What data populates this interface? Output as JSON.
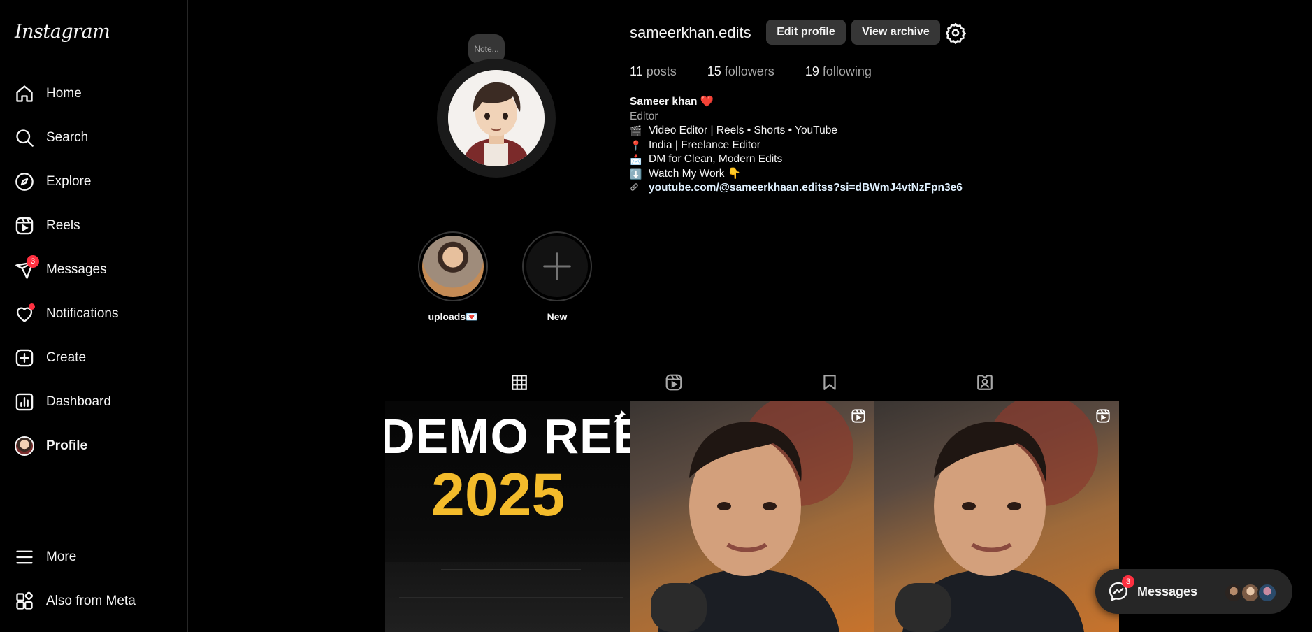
{
  "app": {
    "logo": "Instagram"
  },
  "sidebar": {
    "items": [
      {
        "label": "Home",
        "icon": "home-icon"
      },
      {
        "label": "Search",
        "icon": "search-icon"
      },
      {
        "label": "Explore",
        "icon": "explore-icon"
      },
      {
        "label": "Reels",
        "icon": "reels-icon"
      },
      {
        "label": "Messages",
        "icon": "messages-icon",
        "badge": "3"
      },
      {
        "label": "Notifications",
        "icon": "heart-icon"
      },
      {
        "label": "Create",
        "icon": "create-icon"
      },
      {
        "label": "Dashboard",
        "icon": "dashboard-icon"
      },
      {
        "label": "Profile",
        "icon": "avatar"
      },
      {
        "label": "More",
        "icon": "menu-icon"
      },
      {
        "label": "Also from Meta",
        "icon": "meta-apps-icon"
      }
    ]
  },
  "profile": {
    "note": "Note...",
    "username": "sameerkhan.edits",
    "edit_profile": "Edit profile",
    "view_archive": "View archive",
    "stats": {
      "posts_count": "11",
      "posts_label": "posts",
      "followers_count": "15",
      "followers_label": "followers",
      "following_count": "19",
      "following_label": "following"
    },
    "bio": {
      "name": "Sameer khan ❤️",
      "category": "Editor",
      "line1_emoji": "🎬",
      "line1": "Video Editor | Reels • Shorts • YouTube",
      "line2_emoji": "📍",
      "line2": "India | Freelance Editor",
      "line3_emoji": "📩",
      "line3": "DM for Clean, Modern Edits",
      "line4_emoji": "⬇️",
      "line4": "Watch My Work 👇",
      "link": "youtube.com/@sameerkhaan.editss?si=dBWmJ4vtNzFpn3e6"
    }
  },
  "highlights": [
    {
      "label": "uploads💌"
    },
    {
      "label": "New"
    }
  ],
  "posts": {
    "tile1_line1": "DEMO REEL",
    "tile1_line2": "2025"
  },
  "messages_pill": {
    "label": "Messages",
    "badge": "3"
  }
}
